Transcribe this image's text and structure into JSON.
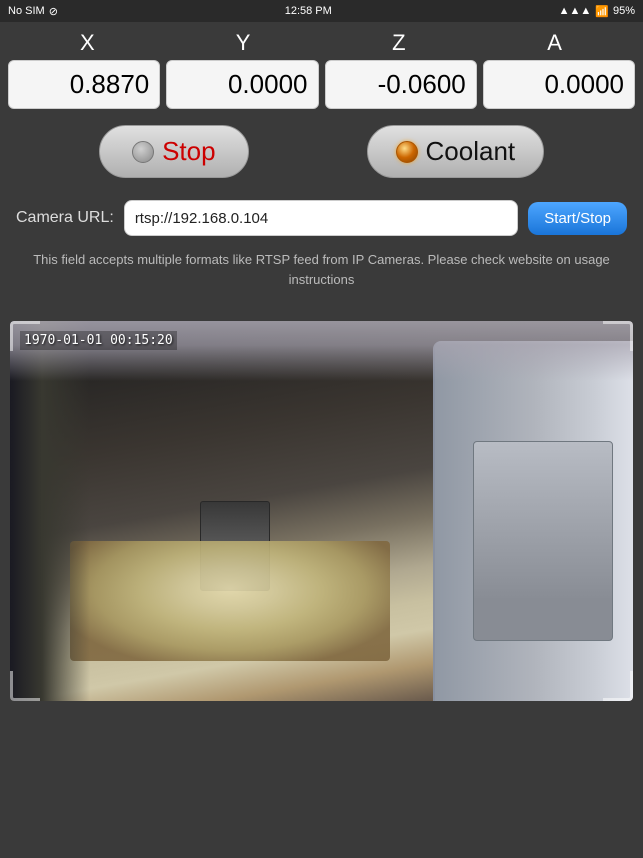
{
  "statusBar": {
    "carrier": "No SIM",
    "time": "12:58 PM",
    "wifi": "WiFi",
    "battery": "95%"
  },
  "axes": {
    "labels": [
      "X",
      "Y",
      "Z",
      "A"
    ],
    "values": [
      "0.8870",
      "0.0000",
      "-0.0600",
      "0.0000"
    ]
  },
  "controls": {
    "stop_label": "Stop",
    "coolant_label": "Coolant"
  },
  "camera": {
    "url_label": "Camera URL:",
    "url_value": "rtsp://192.168.0.104",
    "url_placeholder": "rtsp://192.168.0.104",
    "start_stop_label": "Start/Stop",
    "help_text": "This field accepts multiple formats like RTSP feed from IP Cameras.  Please check website on usage instructions",
    "timestamp": "1970-01-01 00:15:20"
  }
}
